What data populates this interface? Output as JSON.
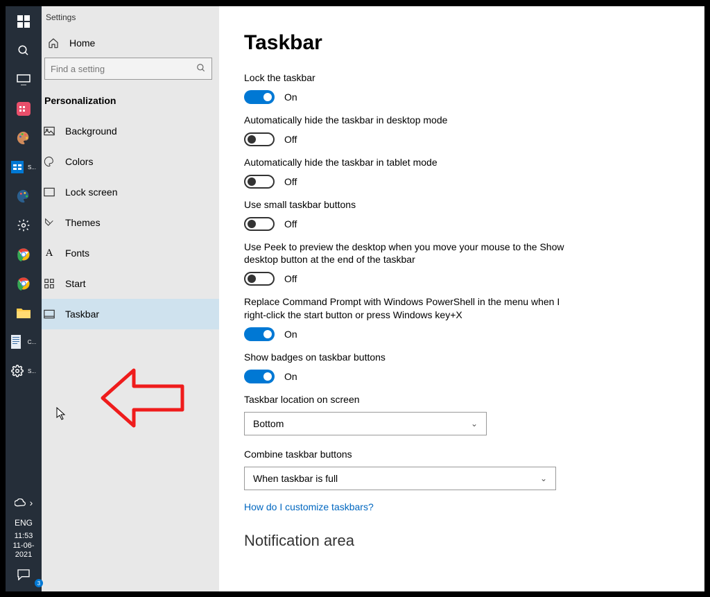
{
  "window": {
    "title": "Settings"
  },
  "sidebar": {
    "home": "Home",
    "search_placeholder": "Find a setting",
    "section": "Personalization",
    "items": [
      {
        "label": "Background"
      },
      {
        "label": "Colors"
      },
      {
        "label": "Lock screen"
      },
      {
        "label": "Themes"
      },
      {
        "label": "Fonts"
      },
      {
        "label": "Start"
      },
      {
        "label": "Taskbar"
      }
    ]
  },
  "content": {
    "page_title": "Taskbar",
    "settings": [
      {
        "label": "Lock the taskbar",
        "state": "On",
        "on": true
      },
      {
        "label": "Automatically hide the taskbar in desktop mode",
        "state": "Off",
        "on": false
      },
      {
        "label": "Automatically hide the taskbar in tablet mode",
        "state": "Off",
        "on": false
      },
      {
        "label": "Use small taskbar buttons",
        "state": "Off",
        "on": false
      },
      {
        "label": "Use Peek to preview the desktop when you move your mouse to the Show desktop button at the end of the taskbar",
        "state": "Off",
        "on": false
      },
      {
        "label": "Replace Command Prompt with Windows PowerShell in the menu when I right-click the start button or press Windows key+X",
        "state": "On",
        "on": true
      },
      {
        "label": "Show badges on taskbar buttons",
        "state": "On",
        "on": true
      }
    ],
    "location_label": "Taskbar location on screen",
    "location_value": "Bottom",
    "combine_label": "Combine taskbar buttons",
    "combine_value": "When taskbar is full",
    "help_link": "How do I customize taskbars?",
    "next_section": "Notification area"
  },
  "taskbar": {
    "items_top": [
      "start",
      "search",
      "task-view",
      "app1",
      "paint",
      "app-s",
      "tools",
      "settings-gear",
      "chrome-1",
      "chrome-2",
      "file-explorer",
      "word-c",
      "settings-s"
    ],
    "lang": "ENG",
    "time": "11:53",
    "date": "11-06-2021",
    "notif_badge": "3"
  },
  "ui": {
    "on_label": "On",
    "off_label": "Off"
  }
}
